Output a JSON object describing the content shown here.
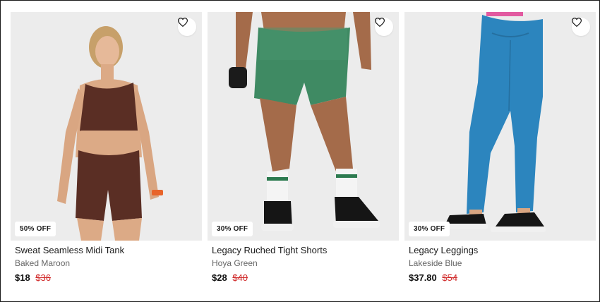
{
  "products": [
    {
      "name": "Sweat Seamless Midi Tank",
      "color": "Baked Maroon",
      "price": "$18",
      "was_price": "$36",
      "badge": "50% OFF"
    },
    {
      "name": "Legacy Ruched Tight Shorts",
      "color": "Hoya Green",
      "price": "$28",
      "was_price": "$40",
      "badge": "30% OFF"
    },
    {
      "name": "Legacy Leggings",
      "color": "Lakeside Blue",
      "price": "$37.80",
      "was_price": "$54",
      "badge": "30% OFF"
    }
  ],
  "icons": {
    "wishlist": "heart-outline-icon"
  },
  "colors": {
    "sale_price": "#d12b2b",
    "maroon": "#5a2e24",
    "green": "#3f8a63",
    "blue": "#2c85be",
    "image_bg": "#eeeeee"
  }
}
